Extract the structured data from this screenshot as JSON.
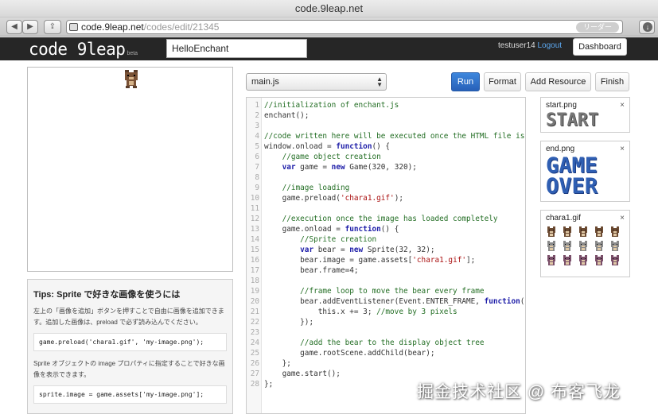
{
  "browser": {
    "title": "code.9leap.net",
    "address_host": "code.9leap.net",
    "address_path": "/codes/edit/21345",
    "reader_label": "リーダー"
  },
  "header": {
    "logo_text": "code 9leap",
    "beta_label": "beta",
    "title_value": "HelloEnchant",
    "username": "testuser14",
    "logout_label": "Logout",
    "dashboard_label": "Dashboard"
  },
  "tips": {
    "heading": "Tips: Sprite で好きな画像を使うには",
    "para1": "左上の「画像を追加」ボタンを押すことで自由に画像を追加できます。追加した画像は、preload で必ず読み込んでください。",
    "code1": "game.preload('chara1.gif', 'my-image.png');",
    "para2": "Sprite オブジェクトの image プロパティに指定することで好きな画像を表示できます。",
    "code2": "sprite.image = game.assets['my-image.png'];"
  },
  "editor": {
    "file_selected": "main.js",
    "buttons": {
      "run": "Run",
      "format": "Format",
      "add_resource": "Add Resource",
      "finish": "Finish"
    },
    "lines": [
      "//initialization of enchant.js",
      "enchant();",
      "",
      "//code written here will be executed once the HTML file is",
      "window.onload = function() {",
      "    //game object creation",
      "    var game = new Game(320, 320);",
      "",
      "    //image loading",
      "    game.preload('chara1.gif');",
      "",
      "    //execution once the image has loaded completely",
      "    game.onload = function() {",
      "        //Sprite creation",
      "        var bear = new Sprite(32, 32);",
      "        bear.image = game.assets['chara1.gif'];",
      "        bear.frame=4;",
      "",
      "        //frame loop to move the bear every frame",
      "        bear.addEventListener(Event.ENTER_FRAME, function(",
      "            this.x += 3; //move by 3 pixels",
      "        });",
      "",
      "        //add the bear to the display object tree",
      "        game.rootScene.addChild(bear);",
      "    };",
      "    game.start();",
      "};"
    ]
  },
  "resources": [
    {
      "name": "start.png",
      "image_text": "START",
      "close": "×"
    },
    {
      "name": "end.png",
      "image_text_1": "GAME",
      "image_text_2": "OVER",
      "close": "×"
    },
    {
      "name": "chara1.gif",
      "close": "×"
    }
  ],
  "watermark": "掘金技术社区 @ 布客飞龙",
  "colors": {
    "run_button": "#2f6fc9",
    "header_bg": "#262626",
    "gameover_blue": "#2f5fb3"
  }
}
